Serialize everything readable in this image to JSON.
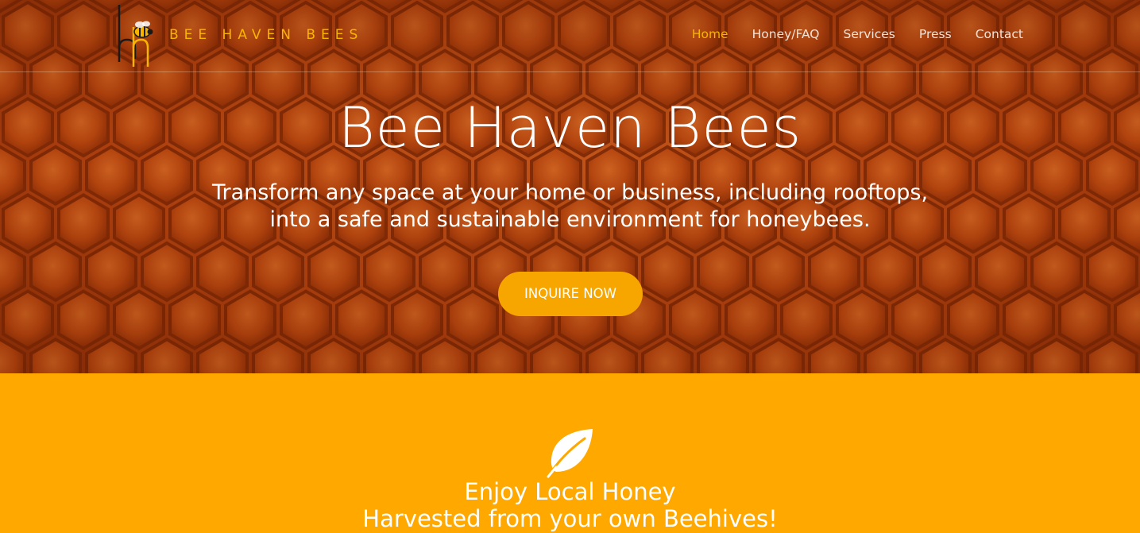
{
  "brand": {
    "name": "BEE HAVEN BEES",
    "logo_icon": "bee-monogram-logo",
    "accent_color": "#f7b500"
  },
  "nav": {
    "items": [
      {
        "label": "Home",
        "active": true
      },
      {
        "label": "Honey/FAQ",
        "active": false
      },
      {
        "label": "Services",
        "active": false
      },
      {
        "label": "Press",
        "active": false
      },
      {
        "label": "Contact",
        "active": false
      }
    ]
  },
  "hero": {
    "title": "Bee Haven Bees",
    "subtitle_line1": "Transform any space at your home or business, including rooftops,",
    "subtitle_line2": "into a safe and sustainable environment for honeybees.",
    "cta_label": "INQUIRE NOW",
    "cta_color": "#f7a600",
    "background": "honeycomb-photo"
  },
  "feature": {
    "icon": "leaf-icon",
    "title_line1": "Enjoy Local Honey",
    "title_line2": "Harvested from your own Beehives!",
    "background_color": "#ffa800"
  }
}
